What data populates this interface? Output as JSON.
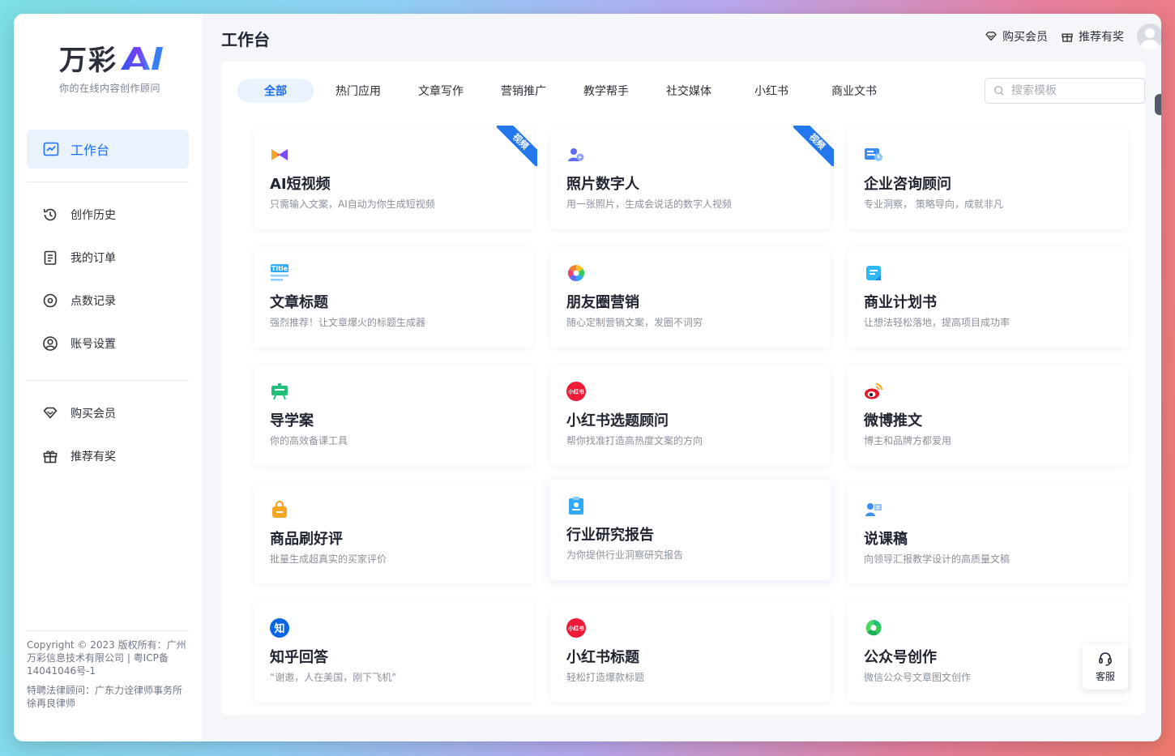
{
  "brand": {
    "name": "万彩",
    "tagline": "你的在线内容创作顾问"
  },
  "sidebar": {
    "active": {
      "label": "工作台",
      "icon": "chart-icon"
    },
    "items": [
      {
        "label": "创作历史",
        "icon": "history-icon"
      },
      {
        "label": "我的订单",
        "icon": "order-icon"
      },
      {
        "label": "点数记录",
        "icon": "points-icon"
      },
      {
        "label": "账号设置",
        "icon": "user-icon"
      }
    ],
    "extra": [
      {
        "label": "购买会员",
        "icon": "diamond-icon"
      },
      {
        "label": "推荐有奖",
        "icon": "gift-icon"
      }
    ],
    "footer": {
      "copyright": "Copyright © 2023 版权所有：广州万彩信息技术有限公司 | 粤ICP备14041046号-1",
      "legal": "特聘法律顾问：广东力诠律师事务所徐再良律师"
    }
  },
  "header": {
    "title": "工作台",
    "buy_member": "购买会员",
    "refer": "推荐有奖"
  },
  "tabs": [
    "全部",
    "热门应用",
    "文章写作",
    "营销推广",
    "教学帮手",
    "社交媒体",
    "小红书",
    "商业文书"
  ],
  "search": {
    "placeholder": "搜索模板"
  },
  "cards": [
    {
      "title": "AI短视频",
      "desc": "只需输入文案，AI自动为你生成短视频",
      "icon": "video-play-icon",
      "badge": "视频"
    },
    {
      "title": "照片数字人",
      "desc": "用一张照片，生成会说话的数字人视频",
      "icon": "digital-human-icon",
      "badge": "视频"
    },
    {
      "title": "企业咨询顾问",
      "desc": "专业洞察， 策略导向，成就非凡",
      "icon": "consult-icon"
    },
    {
      "title": "文章标题",
      "desc": "强烈推荐！让文章爆火的标题生成器",
      "icon": "title-icon"
    },
    {
      "title": "朋友圈营销",
      "desc": "随心定制营销文案，发圈不词穷",
      "icon": "moments-icon"
    },
    {
      "title": "商业计划书",
      "desc": "让想法轻松落地，提高项目成功率",
      "icon": "plan-icon"
    },
    {
      "title": "导学案",
      "desc": "你的高效备课工具",
      "icon": "blackboard-icon"
    },
    {
      "title": "小红书选题顾问",
      "desc": "帮你找准打造高热度文案的方向",
      "icon": "xiaohongshu-icon"
    },
    {
      "title": "微博推文",
      "desc": "博主和品牌方都爱用",
      "icon": "weibo-icon"
    },
    {
      "title": "商品刷好评",
      "desc": "批量生成超真实的买家评价",
      "icon": "shopping-bag-icon"
    },
    {
      "title": "行业研究报告",
      "desc": "为你提供行业洞察研究报告",
      "icon": "report-icon"
    },
    {
      "title": "说课稿",
      "desc": "向领导汇报教学设计的高质量文稿",
      "icon": "lecture-icon"
    },
    {
      "title": "知乎回答",
      "desc": "“谢邀，人在美国，刚下飞机”",
      "icon": "zhihu-icon"
    },
    {
      "title": "小红书标题",
      "desc": "轻松打造爆款标题",
      "icon": "xiaohongshu-icon"
    },
    {
      "title": "公众号创作",
      "desc": "微信公众号文章图文创作",
      "icon": "wechat-official-icon"
    }
  ],
  "service": {
    "label": "客服"
  },
  "icon_text": {
    "zhihu": "知",
    "xhs": "小红书",
    "title": "Title"
  }
}
